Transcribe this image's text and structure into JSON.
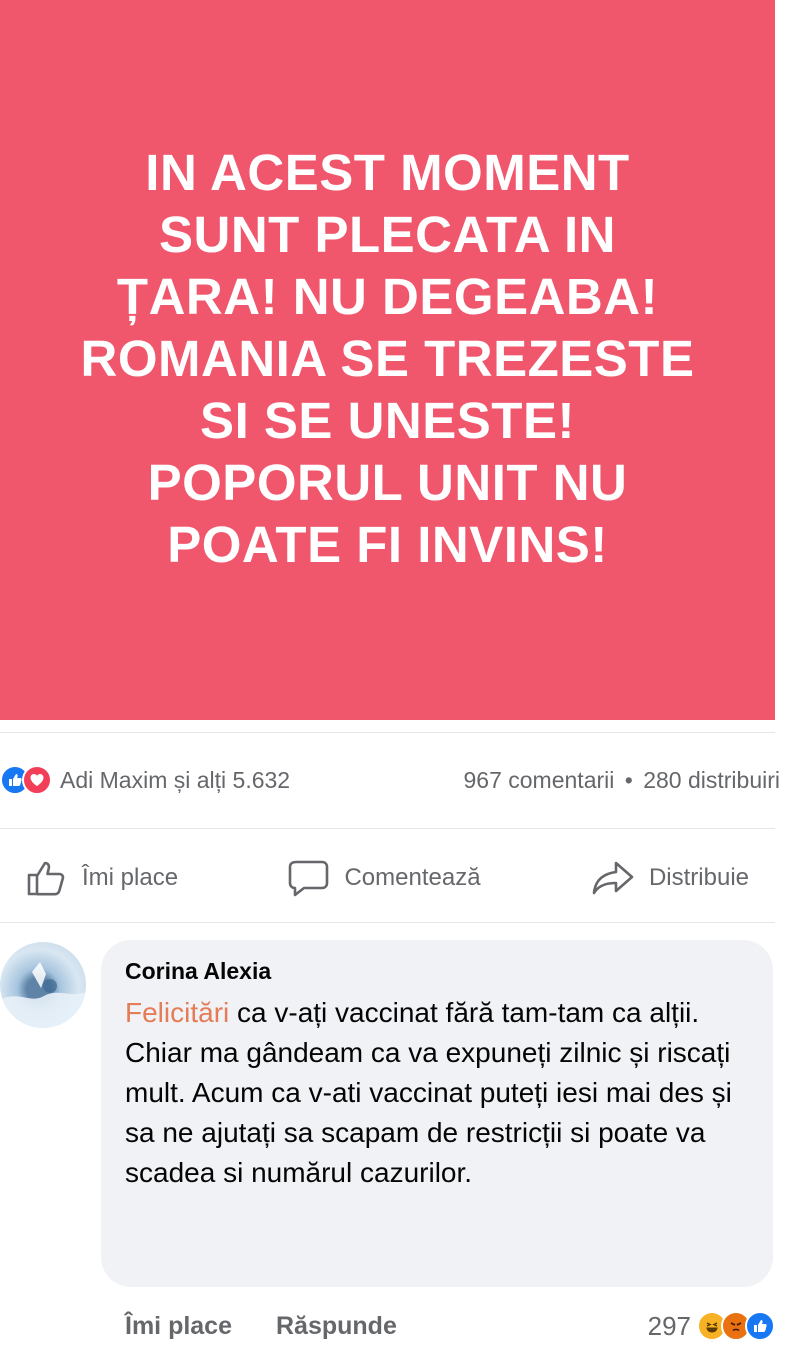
{
  "post": {
    "image_text": "IN ACEST MOMENT SUNT PLECATA IN ȚARA! NU DEGEABA! ROMANIA SE TREZESTE SI SE UNESTE! POPORUL UNIT NU POATE FI INVINS!",
    "background_color": "#f0576d"
  },
  "stats": {
    "reactions_text": "Adi Maxim și alți 5.632",
    "comments_text": "967 comentarii",
    "separator": "•",
    "shares_text": "280 distribuiri",
    "reaction_icons": [
      "like-icon",
      "love-icon"
    ]
  },
  "actions": {
    "like_label": "Îmi place",
    "comment_label": "Comentează",
    "share_label": "Distribuie"
  },
  "comment": {
    "author": "Corina Alexia",
    "highlight_word": "Felicitări",
    "text": " ca v-ați vaccinat fără tam-tam ca alții. Chiar ma gândeam ca va expuneți zilnic și riscați mult. Acum ca v-ati vaccinat puteți iesi mai des și sa ne ajutați sa scapam de restricții si poate va scadea si numărul cazurilor.",
    "like_label": "Îmi place",
    "reply_label": "Răspunde",
    "reaction_count": "297",
    "reaction_icons": [
      "haha-icon",
      "angry-icon",
      "like-icon"
    ]
  }
}
